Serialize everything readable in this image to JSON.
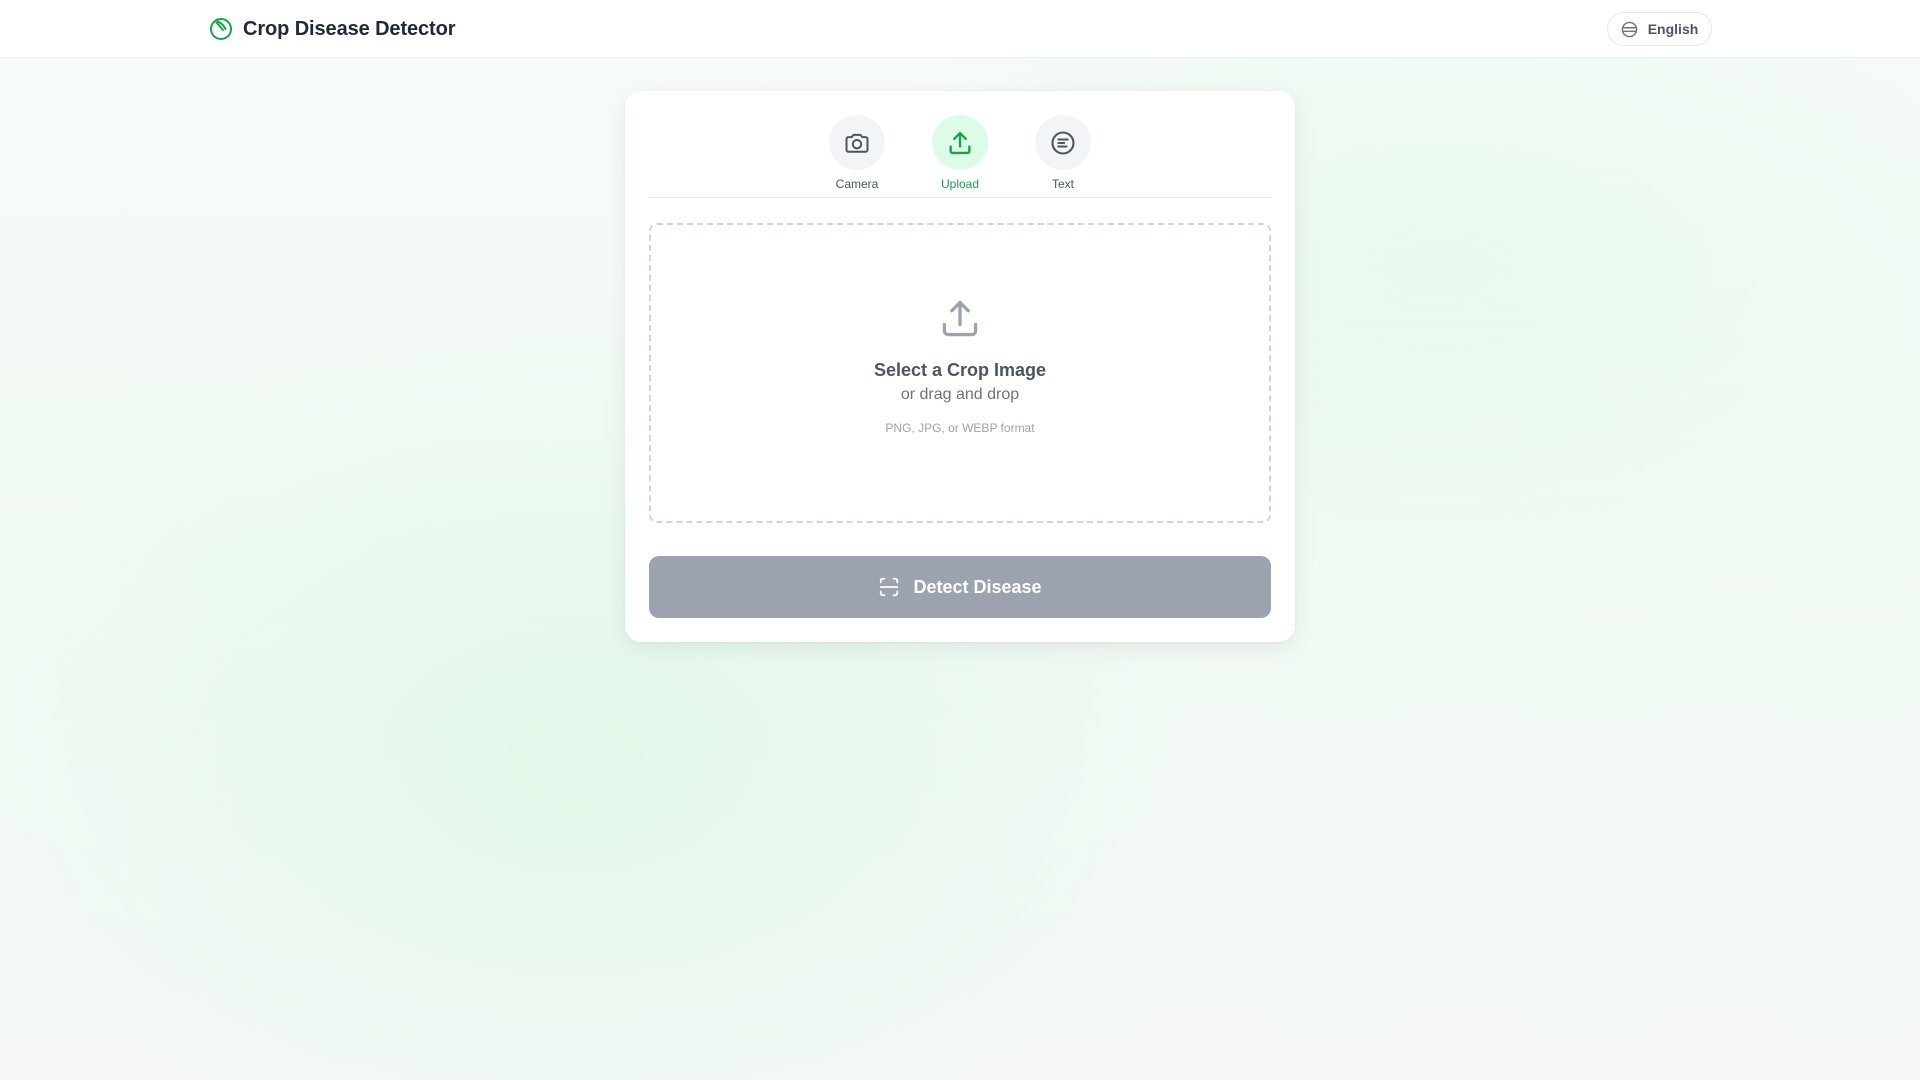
{
  "header": {
    "title": "Crop Disease Detector",
    "brand_icon": "leaf-circle-icon",
    "language_label": "English",
    "language_icon": "globe-icon"
  },
  "modes": [
    {
      "label": "Camera",
      "icon": "camera-icon",
      "active": false
    },
    {
      "label": "Upload",
      "icon": "upload-icon",
      "active": true
    },
    {
      "label": "Text",
      "icon": "text-bubble-icon",
      "active": false
    }
  ],
  "dropzone": {
    "icon": "upload-icon",
    "title": "Select a Crop Image",
    "subtitle": "or drag and drop",
    "formats": "PNG, JPG, or WEBP format"
  },
  "action": {
    "label": "Detect Disease",
    "icon": "scan-icon",
    "disabled": true
  },
  "colors": {
    "accent": "#16a34a",
    "accent_light": "#dcfce7",
    "button_disabled": "#9ca3af",
    "text_primary": "#1f2937"
  }
}
